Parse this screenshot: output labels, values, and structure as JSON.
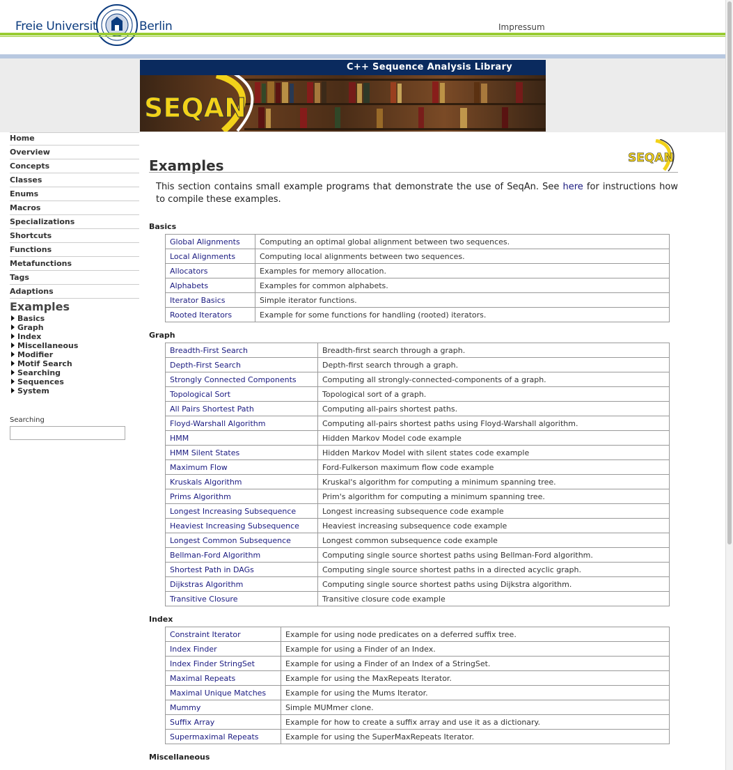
{
  "header": {
    "fu_left": "Freie Universität",
    "fu_right": "Berlin",
    "impressum": "Impressum"
  },
  "banner": {
    "title": "C++ Sequence Analysis Library",
    "logo_text": "SEQAN"
  },
  "nav": {
    "items": [
      "Home",
      "Overview",
      "Concepts",
      "Classes",
      "Enums",
      "Macros",
      "Specializations",
      "Shortcuts",
      "Functions",
      "Metafunctions",
      "Tags",
      "Adaptions"
    ],
    "heading": "Examples",
    "subitems": [
      "Basics",
      "Graph",
      "Index",
      "Miscellaneous",
      "Modifier",
      "Motif Search",
      "Searching",
      "Sequences",
      "System"
    ],
    "search_label": "Searching",
    "search_placeholder": ""
  },
  "main": {
    "title": "Examples",
    "logo_text": "SEQAN",
    "intro_before": "This section contains small example programs that demonstrate the use of SeqAn. See ",
    "intro_link": "here",
    "intro_after": " for instructions how to compile these examples."
  },
  "sections": [
    {
      "title": "Basics",
      "rows": [
        [
          "Global Alignments",
          "Computing an optimal global alignment between two sequences."
        ],
        [
          "Local Alignments",
          "Computing local alignments between two sequences."
        ],
        [
          "Allocators",
          "Examples for memory allocation."
        ],
        [
          "Alphabets",
          "Examples for common alphabets."
        ],
        [
          "Iterator Basics",
          "Simple iterator functions."
        ],
        [
          "Rooted Iterators",
          "Example for some functions for handling (rooted) iterators."
        ]
      ]
    },
    {
      "title": "Graph",
      "rows": [
        [
          "Breadth-First Search",
          "Breadth-first search through a graph."
        ],
        [
          "Depth-First Search",
          "Depth-first search through a graph."
        ],
        [
          "Strongly Connected Components",
          "Computing all strongly-connected-components of a graph."
        ],
        [
          "Topological Sort",
          "Topological sort of a graph."
        ],
        [
          "All Pairs Shortest Path",
          "Computing all-pairs shortest paths."
        ],
        [
          "Floyd-Warshall Algorithm",
          "Computing all-pairs shortest paths using Floyd-Warshall algorithm."
        ],
        [
          "HMM",
          "Hidden Markov Model code example"
        ],
        [
          "HMM Silent States",
          "Hidden Markov Model with silent states code example"
        ],
        [
          "Maximum Flow",
          "Ford-Fulkerson maximum flow code example"
        ],
        [
          "Kruskals Algorithm",
          "Kruskal's algorithm for computing a minimum spanning tree."
        ],
        [
          "Prims Algorithm",
          "Prim's algorithm for computing a minimum spanning tree."
        ],
        [
          "Longest Increasing Subsequence",
          "Longest increasing subsequence code example"
        ],
        [
          "Heaviest Increasing Subsequence",
          "Heaviest increasing subsequence code example"
        ],
        [
          "Longest Common Subsequence",
          "Longest common subsequence code example"
        ],
        [
          "Bellman-Ford Algorithm",
          "Computing single source shortest paths using Bellman-Ford algorithm."
        ],
        [
          "Shortest Path in DAGs",
          "Computing single source shortest paths in a directed acyclic graph."
        ],
        [
          "Dijkstras Algorithm",
          "Computing single source shortest paths using Dijkstra algorithm."
        ],
        [
          "Transitive Closure",
          "Transitive closure code example"
        ]
      ]
    },
    {
      "title": "Index",
      "rows": [
        [
          "Constraint Iterator",
          "Example for using node predicates on a deferred suffix tree."
        ],
        [
          "Index Finder",
          "Example for using a Finder of an Index."
        ],
        [
          "Index Finder StringSet",
          "Example for using a Finder of an Index of a StringSet."
        ],
        [
          "Maximal Repeats",
          "Example for using the MaxRepeats Iterator."
        ],
        [
          "Maximal Unique Matches",
          "Example for using the Mums Iterator."
        ],
        [
          "Mummy",
          "Simple MUMmer clone."
        ],
        [
          "Suffix Array",
          "Example for how to create a suffix array and use it as a dictionary."
        ],
        [
          "Supermaximal Repeats",
          "Example for using the SuperMaxRepeats Iterator."
        ]
      ]
    },
    {
      "title": "Miscellaneous",
      "rows": []
    }
  ]
}
